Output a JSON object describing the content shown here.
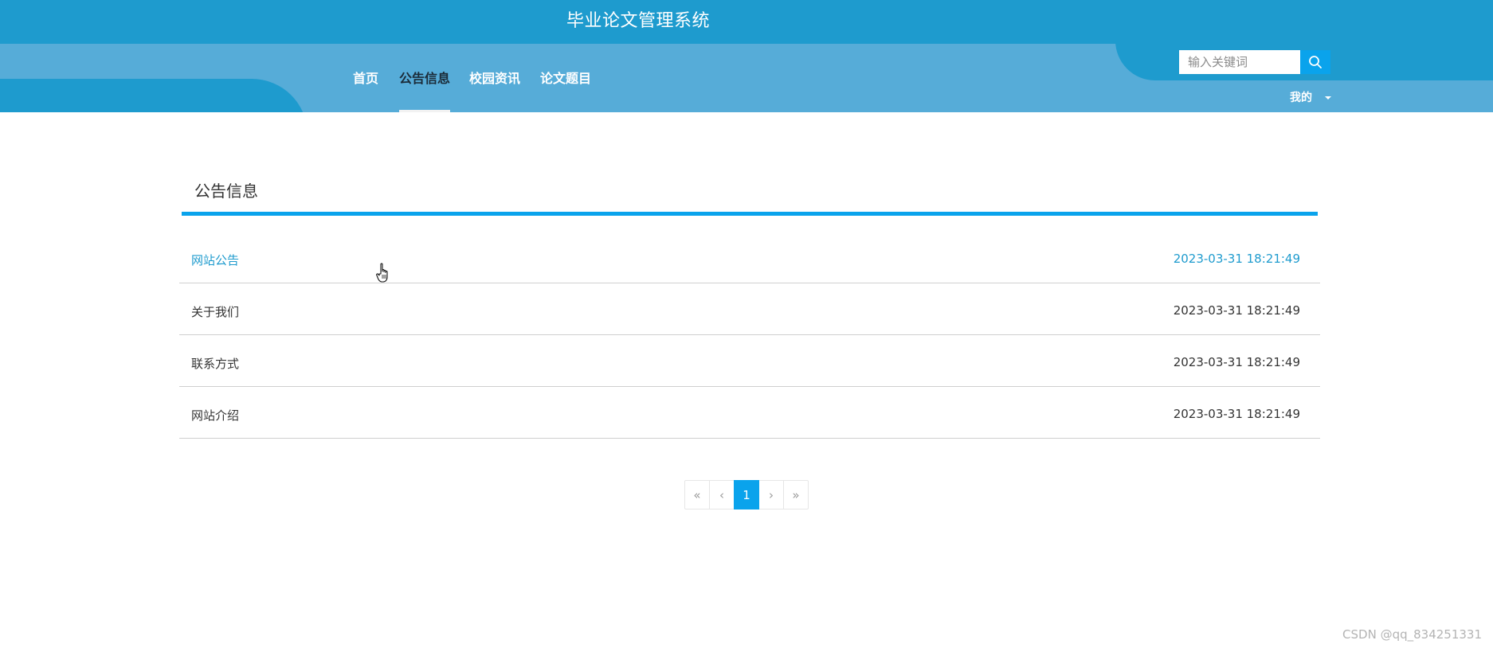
{
  "site": {
    "title": "毕业论文管理系统"
  },
  "nav": {
    "items": [
      {
        "label": "首页",
        "active": false
      },
      {
        "label": "公告信息",
        "active": true
      },
      {
        "label": "校园资讯",
        "active": false
      },
      {
        "label": "论文题目",
        "active": false
      }
    ]
  },
  "search": {
    "placeholder": "输入关键词",
    "value": "",
    "icon": "search-icon"
  },
  "user_menu": {
    "label": "我的",
    "icon": "caret-down-icon"
  },
  "section": {
    "title": "公告信息"
  },
  "notices": [
    {
      "title": "网站公告",
      "time": "2023-03-31 18:21:49",
      "hover": true
    },
    {
      "title": "关于我们",
      "time": "2023-03-31 18:21:49",
      "hover": false
    },
    {
      "title": "联系方式",
      "time": "2023-03-31 18:21:49",
      "hover": false
    },
    {
      "title": "网站介绍",
      "time": "2023-03-31 18:21:49",
      "hover": false
    }
  ],
  "pagination": {
    "first": "«",
    "prev": "‹",
    "current": "1",
    "next": "›",
    "last": "»"
  },
  "watermark": "CSDN @qq_834251331",
  "colors": {
    "header_dark": "#1e9bce",
    "header_light": "#56acd8",
    "accent": "#0aa3ec",
    "active_nav_text": "#1b2b38",
    "hover_link": "#1e9bce"
  }
}
